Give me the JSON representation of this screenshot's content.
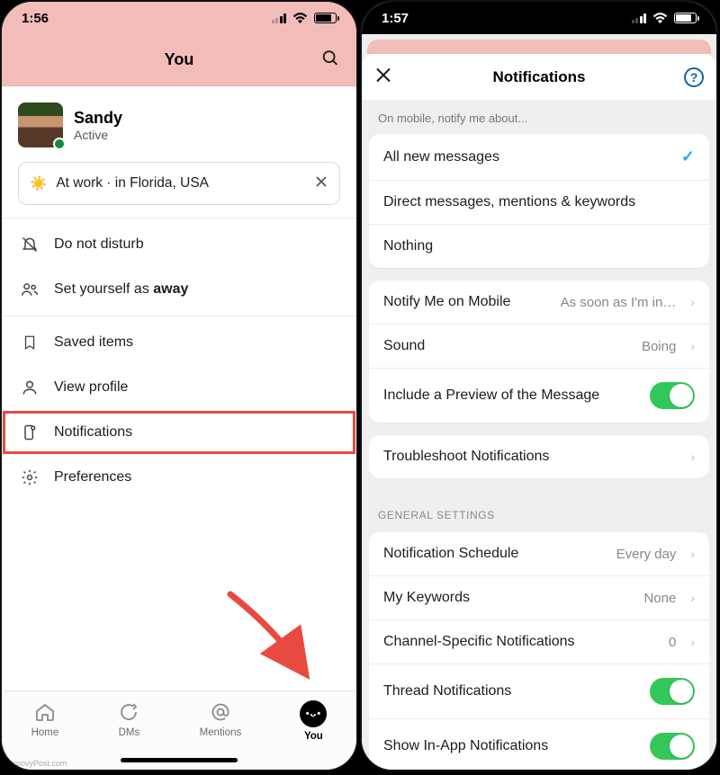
{
  "left": {
    "status_time": "1:56",
    "header_title": "You",
    "profile": {
      "name": "Sandy",
      "presence": "Active"
    },
    "status_text": "At work · in Florida, USA",
    "menu": {
      "dnd": "Do not disturb",
      "away_prefix": "Set yourself as ",
      "away_bold": "away",
      "saved": "Saved items",
      "view_profile": "View profile",
      "notifications": "Notifications",
      "preferences": "Preferences"
    },
    "tabs": {
      "home": "Home",
      "dms": "DMs",
      "mentions": "Mentions",
      "you": "You"
    }
  },
  "right": {
    "status_time": "1:57",
    "sheet_title": "Notifications",
    "section_hint": "On mobile, notify me about...",
    "options": {
      "all": "All new messages",
      "dm": "Direct messages, mentions & keywords",
      "nothing": "Nothing"
    },
    "rows": {
      "notify_mobile": "Notify Me on Mobile",
      "notify_mobile_val": "As soon as I'm in…",
      "sound": "Sound",
      "sound_val": "Boing",
      "preview": "Include a Preview of the Message",
      "troubleshoot": "Troubleshoot Notifications",
      "schedule": "Notification Schedule",
      "schedule_val": "Every day",
      "keywords": "My Keywords",
      "keywords_val": "None",
      "channel": "Channel-Specific Notifications",
      "channel_val": "0",
      "thread": "Thread Notifications",
      "inapp": "Show In-App Notifications"
    },
    "general_header": "GENERAL SETTINGS"
  },
  "watermark": "groovyPost.com"
}
